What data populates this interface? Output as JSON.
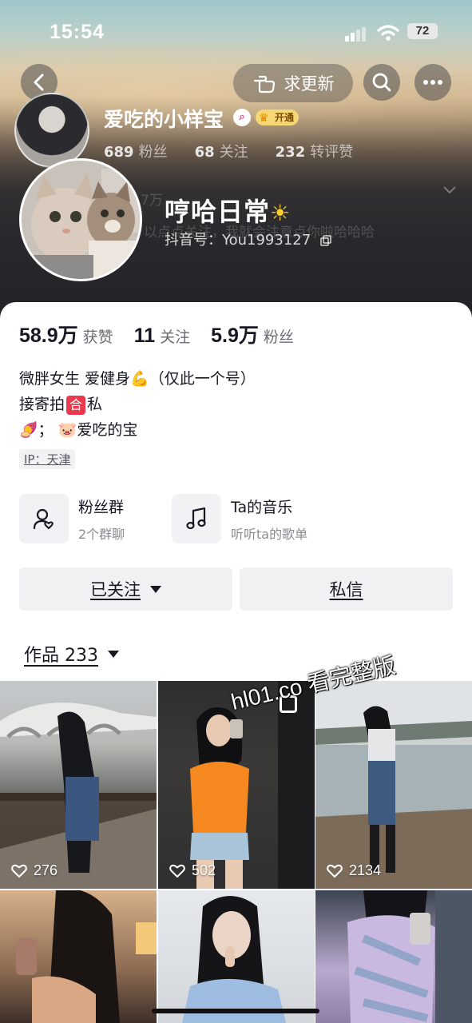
{
  "status_bar": {
    "time": "15:54",
    "battery": "72"
  },
  "header": {
    "request_update_label": "求更新",
    "compact_name": "爱吃的小样宝",
    "vip_label": "开通",
    "compact_stats": [
      {
        "num": "689",
        "label": "粉丝"
      },
      {
        "num": "68",
        "label": "关注"
      },
      {
        "num": "232",
        "label": "转评赞"
      }
    ],
    "ghost_text_1": "7万",
    "ghost_text_2": "以点点关注，我就会注意点你啦哈哈哈"
  },
  "profile": {
    "nickname": "哼哈日常",
    "nickname_emoji": "☀",
    "douyin_id": "抖音号：You1993127"
  },
  "stats": [
    {
      "num": "58.9万",
      "label": "获赞"
    },
    {
      "num": "11",
      "label": "关注"
    },
    {
      "num": "5.9万",
      "label": "粉丝"
    }
  ],
  "bio": {
    "line1_a": "微胖女生  爱健身",
    "line1_emoji": "💪",
    "line1_b": "（仅此一个号）",
    "line2_a": "接寄拍",
    "line2_badge": "合",
    "line2_b": "私",
    "line3_a": "🍠",
    "line3_b": "；",
    "line3_c": "🐷",
    "line3_d": "爱吃的宝",
    "ip": "IP：天津"
  },
  "entries": [
    {
      "title": "粉丝群",
      "sub": "2个群聊"
    },
    {
      "title": "Ta的音乐",
      "sub": "听听ta的歌单"
    }
  ],
  "actions": {
    "follow_label": "已关注",
    "message_label": "私信"
  },
  "works": {
    "tab_label": "作品 233"
  },
  "grid": [
    {
      "likes": "276"
    },
    {
      "likes": "502"
    },
    {
      "likes": "2134"
    }
  ],
  "watermark": "hl01.co 看完整版"
}
